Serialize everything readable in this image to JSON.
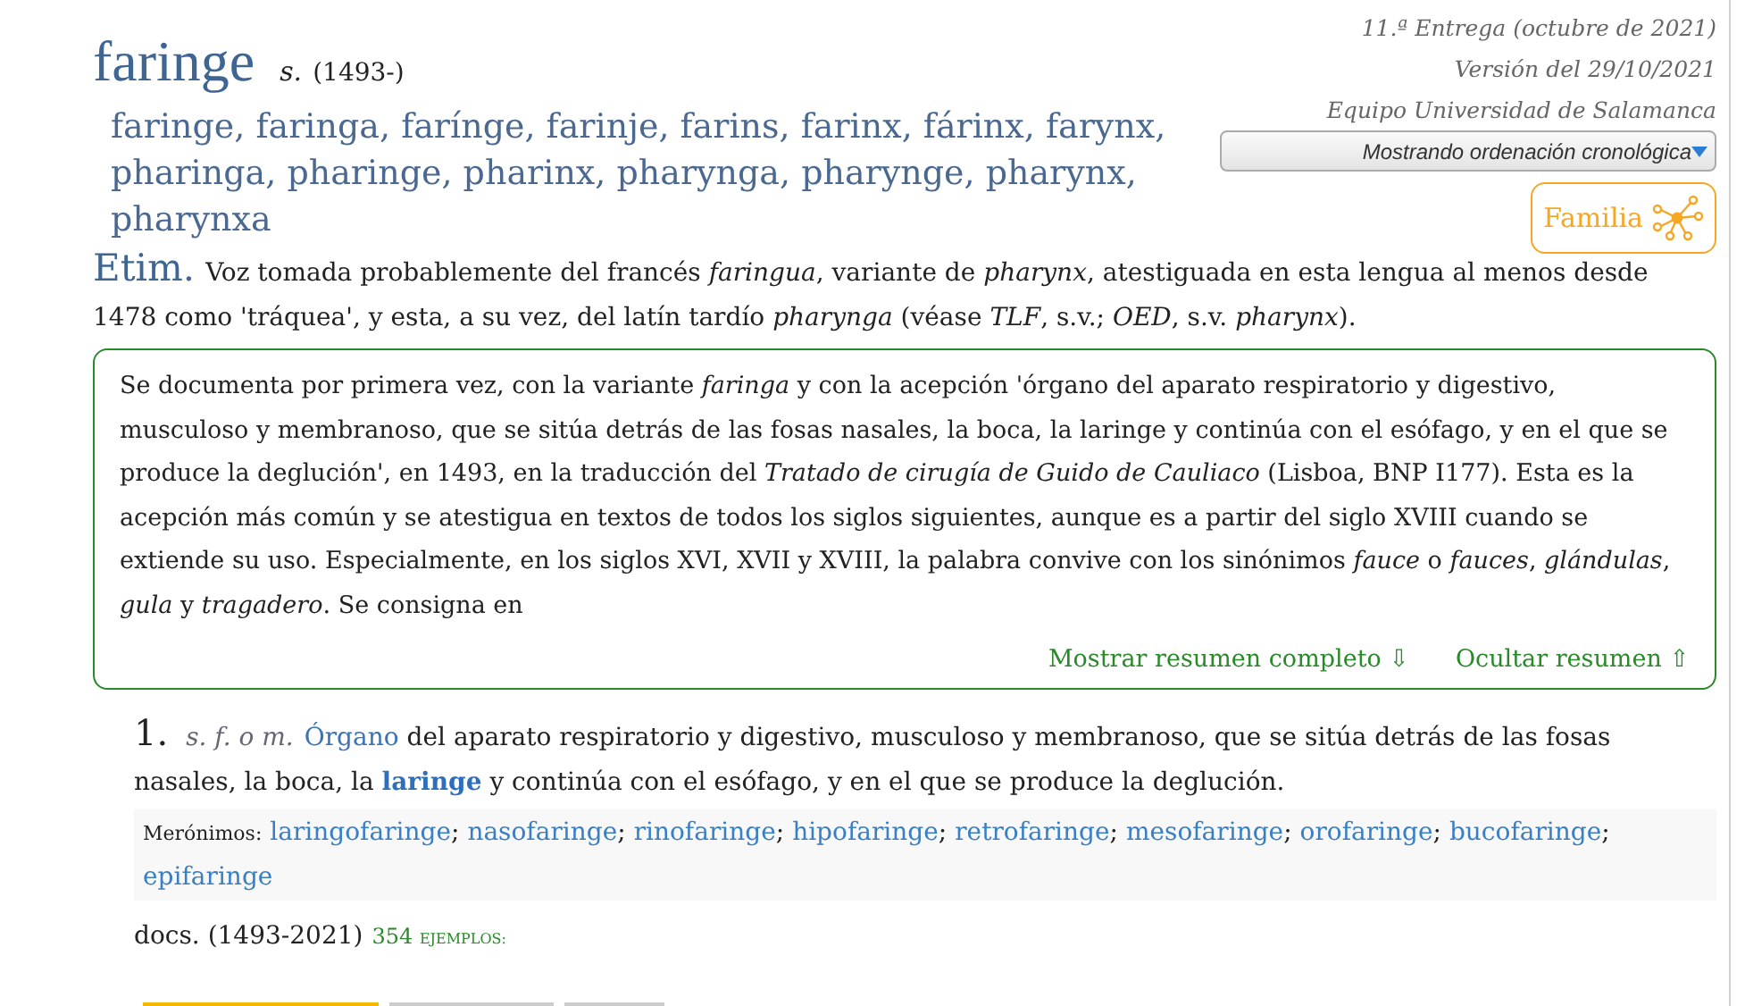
{
  "entry": {
    "headword": "faringe",
    "pos": "s.",
    "date": "(1493-)",
    "variants": "faringe, faringa, farínge, farinje, farins, farinx, fárinx, farynx, pharinga, pharinge, pharinx, pharynga, pharynge, pharynx, pharynxa"
  },
  "meta": {
    "delivery": "11.ª Entrega (octubre de 2021)",
    "version": "Versión del 29/10/2021",
    "team": "Equipo Universidad de Salamanca",
    "sort_dropdown": "Mostrando ordenación cronológica",
    "family_button": "Familia"
  },
  "etymology": {
    "label": "Etim.",
    "text": "Voz tomada probablemente del francés *faringua*, variante de *pharynx*, atestiguada en esta lengua al menos desde 1478 como 'tráquea', y esta, a su vez, del latín tardío *pharynga* (véase *TLF*, s.v.; *OED*, s.v. *pharynx*)."
  },
  "summary": {
    "text": "Se documenta por primera vez, con la variante *faringa* y con la acepción 'órgano del aparato respiratorio y digestivo, musculoso y membranoso, que se sitúa detrás de las fosas nasales, la boca, la laringe y continúa con el esófago, y en el que se produce la deglución', en 1493, en la traducción del *Tratado de cirugía de Guido de Cauliaco* (Lisboa, BNP I177). Esta es la acepción más común y se atestigua en textos de todos los siglos siguientes, aunque es a partir del siglo XVIII cuando se extiende su uso. Especialmente, en los siglos XVI, XVII y XVIII, la palabra convive con los sinónimos *fauce*  o *fauces*, *glándulas*, *gula*  y *tragadero*. Se consigna en",
    "links": [
      "Mostrar resumen completo ⇩",
      "Ocultar resumen ⇧"
    ]
  },
  "senses": [
    {
      "number": "1.",
      "grammar": "s. f. o m.",
      "definition": [
        {
          "kind": "link",
          "text": "Órgano"
        },
        {
          "kind": "plain",
          "text": " del aparato respiratorio y digestivo, musculoso y membranoso, que se sitúa detrás de las fosas nasales, la boca, la "
        },
        {
          "kind": "bold_link",
          "text": "laringe"
        },
        {
          "kind": "plain",
          "text": " y continúa con el esófago, y en el que se produce la deglución."
        }
      ],
      "meronyms": {
        "label": "Merónimos",
        "colon": ":",
        "separator": ";",
        "items": [
          "laringofaringe",
          "nasofaringe",
          "rinofaringe",
          "hipofaringe",
          "retrofaringe",
          "mesofaringe",
          "orofaringe",
          "bucofaringe",
          "epifaringe"
        ]
      },
      "docs": "docs. (1493-2021)",
      "examples_count": "354",
      "examples_label": "EJEMPLOS:"
    }
  ],
  "bottom_tabs": [
    {
      "selected": true
    },
    {
      "selected": false
    },
    {
      "selected": false
    }
  ]
}
